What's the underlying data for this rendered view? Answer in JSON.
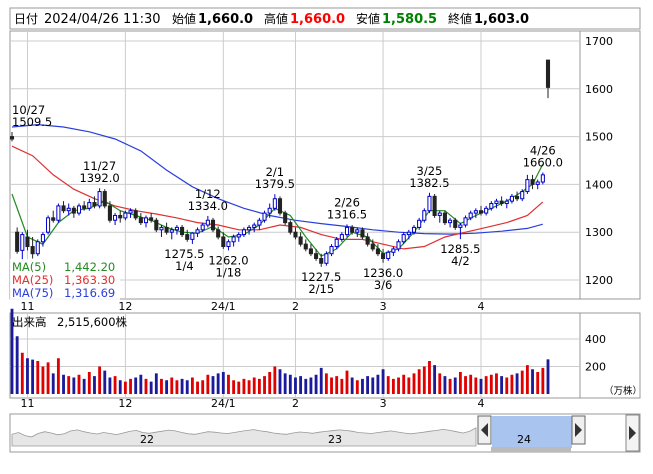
{
  "header": {
    "date_label": "日付",
    "date_value": "2024/04/26 11:30",
    "open_label": "始値",
    "open_value": "1,660.0",
    "high_label": "高値",
    "high_value": "1,660.0",
    "low_label": "安値",
    "low_value": "1,580.5",
    "close_label": "終値",
    "close_value": "1,603.0"
  },
  "colors": {
    "up": "#0000cc",
    "down": "#222222",
    "high": "#ff0000",
    "low": "#008000",
    "ma5": "#228b22",
    "ma25": "#e03030",
    "ma75": "#2a3fdd",
    "volume_up": "#e00000",
    "volume_down": "#1a1a9a",
    "grid": "#cccccc",
    "navigator_fill": "#a9c4ee"
  },
  "legend": [
    {
      "label": "MA(5)",
      "value": "1,442.20",
      "color": "#228b22"
    },
    {
      "label": "MA(25)",
      "value": "1,363.30",
      "color": "#e03030"
    },
    {
      "label": "MA(75)",
      "value": "1,316.69",
      "color": "#2a3fdd"
    }
  ],
  "volume_label": "出来高",
  "volume_value": "2,515,600株",
  "volume_unit": "（万株）",
  "navigator_labels": [
    "22",
    "23",
    "24"
  ],
  "chart_data": {
    "type": "candlestick",
    "price_axis": {
      "ticks": [
        1700,
        1600,
        1500,
        1400,
        1300,
        1200
      ],
      "ylim": [
        1150,
        1720
      ]
    },
    "volume_axis": {
      "ticks": [
        400,
        200
      ],
      "unit": "（万株）"
    },
    "x_tick_labels": [
      "11",
      "12",
      "24/1",
      "2",
      "3",
      "4"
    ],
    "grid": true,
    "annotations": [
      {
        "date": "10/27",
        "value": "1509.5",
        "kind": "high"
      },
      {
        "date": "11/27",
        "value": "1392.0",
        "kind": "high"
      },
      {
        "date": "1/12",
        "value": "1334.0",
        "kind": "high"
      },
      {
        "date": "2/1",
        "value": "1379.5",
        "kind": "high"
      },
      {
        "date": "2/26",
        "value": "1316.5",
        "kind": "high"
      },
      {
        "date": "3/25",
        "value": "1382.5",
        "kind": "high"
      },
      {
        "date": "4/26",
        "value": "1660.0",
        "kind": "high"
      },
      {
        "date": "1/4",
        "value": "1275.5",
        "kind": "low"
      },
      {
        "date": "1/18",
        "value": "1262.0",
        "kind": "low"
      },
      {
        "date": "2/15",
        "value": "1227.5",
        "kind": "low"
      },
      {
        "date": "3/6",
        "value": "1236.0",
        "kind": "low"
      },
      {
        "date": "4/2",
        "value": "1285.5",
        "kind": "low"
      }
    ],
    "candles": [
      [
        1500,
        1509.5,
        1490,
        1495,
        620
      ],
      [
        1300,
        1310,
        1255,
        1260,
        420
      ],
      [
        1262,
        1300,
        1240,
        1295,
        300
      ],
      [
        1290,
        1305,
        1262,
        1270,
        260
      ],
      [
        1270,
        1290,
        1245,
        1255,
        250
      ],
      [
        1255,
        1285,
        1250,
        1280,
        240
      ],
      [
        1280,
        1300,
        1270,
        1295,
        200
      ],
      [
        1300,
        1335,
        1295,
        1330,
        230
      ],
      [
        1330,
        1345,
        1320,
        1325,
        150
      ],
      [
        1325,
        1360,
        1320,
        1355,
        260
      ],
      [
        1355,
        1365,
        1340,
        1345,
        140
      ],
      [
        1345,
        1360,
        1335,
        1350,
        130
      ],
      [
        1350,
        1355,
        1330,
        1340,
        120
      ],
      [
        1340,
        1360,
        1335,
        1355,
        140
      ],
      [
        1355,
        1365,
        1345,
        1350,
        110
      ],
      [
        1350,
        1370,
        1345,
        1362,
        160
      ],
      [
        1362,
        1375,
        1350,
        1355,
        130
      ],
      [
        1355,
        1392,
        1350,
        1385,
        200
      ],
      [
        1385,
        1390,
        1350,
        1355,
        170
      ],
      [
        1355,
        1365,
        1320,
        1325,
        120
      ],
      [
        1325,
        1340,
        1315,
        1335,
        130
      ],
      [
        1335,
        1345,
        1320,
        1330,
        100
      ],
      [
        1330,
        1345,
        1325,
        1340,
        90
      ],
      [
        1340,
        1350,
        1330,
        1345,
        110
      ],
      [
        1345,
        1350,
        1325,
        1330,
        120
      ],
      [
        1330,
        1340,
        1315,
        1320,
        140
      ],
      [
        1320,
        1335,
        1310,
        1330,
        110
      ],
      [
        1330,
        1340,
        1320,
        1325,
        90
      ],
      [
        1325,
        1330,
        1300,
        1305,
        150
      ],
      [
        1305,
        1315,
        1290,
        1310,
        110
      ],
      [
        1310,
        1320,
        1295,
        1300,
        100
      ],
      [
        1300,
        1310,
        1285,
        1305,
        120
      ],
      [
        1305,
        1315,
        1295,
        1310,
        100
      ],
      [
        1310,
        1315,
        1290,
        1295,
        110
      ],
      [
        1295,
        1305,
        1280,
        1285,
        100
      ],
      [
        1285,
        1300,
        1275.5,
        1298,
        120
      ],
      [
        1298,
        1310,
        1290,
        1305,
        90
      ],
      [
        1305,
        1320,
        1300,
        1315,
        100
      ],
      [
        1315,
        1334,
        1310,
        1325,
        140
      ],
      [
        1325,
        1330,
        1300,
        1305,
        130
      ],
      [
        1305,
        1312,
        1285,
        1290,
        150
      ],
      [
        1290,
        1300,
        1265,
        1270,
        160
      ],
      [
        1270,
        1285,
        1262,
        1280,
        140
      ],
      [
        1280,
        1295,
        1270,
        1290,
        100
      ],
      [
        1290,
        1300,
        1280,
        1295,
        90
      ],
      [
        1295,
        1310,
        1290,
        1305,
        110
      ],
      [
        1305,
        1315,
        1295,
        1310,
        100
      ],
      [
        1310,
        1320,
        1300,
        1315,
        120
      ],
      [
        1315,
        1330,
        1305,
        1325,
        110
      ],
      [
        1325,
        1345,
        1320,
        1340,
        130
      ],
      [
        1340,
        1360,
        1330,
        1350,
        160
      ],
      [
        1350,
        1379.5,
        1345,
        1370,
        200
      ],
      [
        1370,
        1375,
        1335,
        1340,
        180
      ],
      [
        1340,
        1345,
        1315,
        1320,
        150
      ],
      [
        1320,
        1325,
        1295,
        1300,
        140
      ],
      [
        1300,
        1310,
        1285,
        1290,
        120
      ],
      [
        1290,
        1300,
        1270,
        1275,
        130
      ],
      [
        1275,
        1285,
        1260,
        1265,
        110
      ],
      [
        1265,
        1275,
        1250,
        1255,
        120
      ],
      [
        1255,
        1265,
        1240,
        1245,
        140
      ],
      [
        1245,
        1255,
        1227.5,
        1235,
        190
      ],
      [
        1235,
        1260,
        1230,
        1255,
        150
      ],
      [
        1255,
        1275,
        1250,
        1270,
        120
      ],
      [
        1270,
        1290,
        1265,
        1285,
        130
      ],
      [
        1285,
        1300,
        1280,
        1295,
        110
      ],
      [
        1295,
        1316.5,
        1290,
        1310,
        170
      ],
      [
        1310,
        1315,
        1295,
        1300,
        120
      ],
      [
        1300,
        1310,
        1290,
        1305,
        100
      ],
      [
        1305,
        1310,
        1285,
        1290,
        110
      ],
      [
        1290,
        1298,
        1270,
        1275,
        130
      ],
      [
        1275,
        1285,
        1260,
        1265,
        120
      ],
      [
        1265,
        1275,
        1250,
        1255,
        140
      ],
      [
        1255,
        1265,
        1236,
        1245,
        180
      ],
      [
        1245,
        1262,
        1240,
        1258,
        130
      ],
      [
        1258,
        1270,
        1250,
        1265,
        110
      ],
      [
        1265,
        1285,
        1260,
        1280,
        120
      ],
      [
        1280,
        1300,
        1275,
        1295,
        140
      ],
      [
        1295,
        1305,
        1285,
        1300,
        120
      ],
      [
        1300,
        1315,
        1295,
        1310,
        150
      ],
      [
        1310,
        1330,
        1305,
        1325,
        180
      ],
      [
        1325,
        1350,
        1320,
        1345,
        200
      ],
      [
        1345,
        1382.5,
        1340,
        1375,
        240
      ],
      [
        1375,
        1380,
        1330,
        1335,
        210
      ],
      [
        1335,
        1345,
        1320,
        1340,
        150
      ],
      [
        1340,
        1345,
        1315,
        1320,
        130
      ],
      [
        1320,
        1330,
        1310,
        1325,
        110
      ],
      [
        1325,
        1330,
        1305,
        1310,
        120
      ],
      [
        1310,
        1320,
        1285.5,
        1315,
        160
      ],
      [
        1315,
        1335,
        1310,
        1330,
        130
      ],
      [
        1330,
        1345,
        1325,
        1340,
        140
      ],
      [
        1340,
        1350,
        1330,
        1345,
        120
      ],
      [
        1345,
        1355,
        1335,
        1340,
        110
      ],
      [
        1340,
        1355,
        1335,
        1350,
        130
      ],
      [
        1350,
        1365,
        1345,
        1360,
        140
      ],
      [
        1360,
        1370,
        1350,
        1365,
        150
      ],
      [
        1365,
        1375,
        1355,
        1360,
        130
      ],
      [
        1360,
        1370,
        1350,
        1365,
        120
      ],
      [
        1365,
        1380,
        1360,
        1375,
        140
      ],
      [
        1375,
        1385,
        1365,
        1370,
        150
      ],
      [
        1370,
        1390,
        1365,
        1385,
        170
      ],
      [
        1385,
        1420,
        1380,
        1410,
        210
      ],
      [
        1410,
        1420,
        1390,
        1400,
        180
      ],
      [
        1400,
        1410,
        1390,
        1405,
        160
      ],
      [
        1405,
        1425,
        1400,
        1420,
        190
      ],
      [
        1660,
        1660,
        1580.5,
        1603,
        252
      ]
    ],
    "ma5": [
      [
        0,
        1380
      ],
      [
        3,
        1290
      ],
      [
        6,
        1275
      ],
      [
        9,
        1320
      ],
      [
        12,
        1345
      ],
      [
        15,
        1350
      ],
      [
        18,
        1365
      ],
      [
        21,
        1345
      ],
      [
        24,
        1335
      ],
      [
        27,
        1325
      ],
      [
        30,
        1310
      ],
      [
        33,
        1300
      ],
      [
        36,
        1298
      ],
      [
        39,
        1312
      ],
      [
        42,
        1290
      ],
      [
        45,
        1295
      ],
      [
        48,
        1315
      ],
      [
        51,
        1350
      ],
      [
        54,
        1335
      ],
      [
        57,
        1290
      ],
      [
        60,
        1250
      ],
      [
        63,
        1265
      ],
      [
        66,
        1300
      ],
      [
        69,
        1290
      ],
      [
        72,
        1255
      ],
      [
        75,
        1265
      ],
      [
        78,
        1300
      ],
      [
        81,
        1345
      ],
      [
        84,
        1345
      ],
      [
        87,
        1318
      ],
      [
        90,
        1335
      ],
      [
        93,
        1350
      ],
      [
        96,
        1365
      ],
      [
        99,
        1385
      ],
      [
        101,
        1400
      ],
      [
        103,
        1442.2
      ]
    ],
    "ma25": [
      [
        0,
        1480
      ],
      [
        4,
        1460
      ],
      [
        8,
        1420
      ],
      [
        12,
        1390
      ],
      [
        16,
        1370
      ],
      [
        20,
        1355
      ],
      [
        24,
        1345
      ],
      [
        28,
        1338
      ],
      [
        32,
        1330
      ],
      [
        36,
        1320
      ],
      [
        40,
        1315
      ],
      [
        44,
        1305
      ],
      [
        48,
        1305
      ],
      [
        52,
        1315
      ],
      [
        56,
        1310
      ],
      [
        60,
        1295
      ],
      [
        64,
        1285
      ],
      [
        68,
        1285
      ],
      [
        72,
        1275
      ],
      [
        76,
        1265
      ],
      [
        80,
        1270
      ],
      [
        84,
        1290
      ],
      [
        88,
        1300
      ],
      [
        92,
        1310
      ],
      [
        96,
        1320
      ],
      [
        100,
        1335
      ],
      [
        103,
        1363.3
      ]
    ],
    "ma75": [
      [
        0,
        1520
      ],
      [
        5,
        1525
      ],
      [
        10,
        1520
      ],
      [
        15,
        1510
      ],
      [
        20,
        1495
      ],
      [
        25,
        1470
      ],
      [
        30,
        1430
      ],
      [
        35,
        1395
      ],
      [
        40,
        1370
      ],
      [
        45,
        1350
      ],
      [
        50,
        1335
      ],
      [
        55,
        1325
      ],
      [
        60,
        1318
      ],
      [
        65,
        1312
      ],
      [
        70,
        1305
      ],
      [
        75,
        1300
      ],
      [
        80,
        1297
      ],
      [
        85,
        1296
      ],
      [
        90,
        1298
      ],
      [
        95,
        1302
      ],
      [
        100,
        1308
      ],
      [
        103,
        1316.69
      ]
    ],
    "x_tick_index": [
      3,
      22,
      41,
      55,
      72,
      91
    ],
    "navigator_series": [
      0.45,
      0.52,
      0.4,
      0.35,
      0.48,
      0.55,
      0.5,
      0.43,
      0.47,
      0.58,
      0.62,
      0.55,
      0.5,
      0.46,
      0.52,
      0.48,
      0.44,
      0.5,
      0.56,
      0.6,
      0.52,
      0.49,
      0.53,
      0.57,
      0.61,
      0.58,
      0.52,
      0.47,
      0.45,
      0.5,
      0.55,
      0.53,
      0.5,
      0.48,
      0.52,
      0.56,
      0.6,
      0.63,
      0.58,
      0.55,
      0.5,
      0.47,
      0.45,
      0.5,
      0.54,
      0.52,
      0.49,
      0.53,
      0.56,
      0.59,
      0.62,
      0.6,
      0.57,
      0.52,
      0.5,
      0.48,
      0.52,
      0.55,
      0.58,
      0.54,
      0.5,
      0.47,
      0.5,
      0.53,
      0.57,
      0.6,
      0.64,
      0.6,
      0.55,
      0.5,
      0.56,
      0.7
    ]
  }
}
